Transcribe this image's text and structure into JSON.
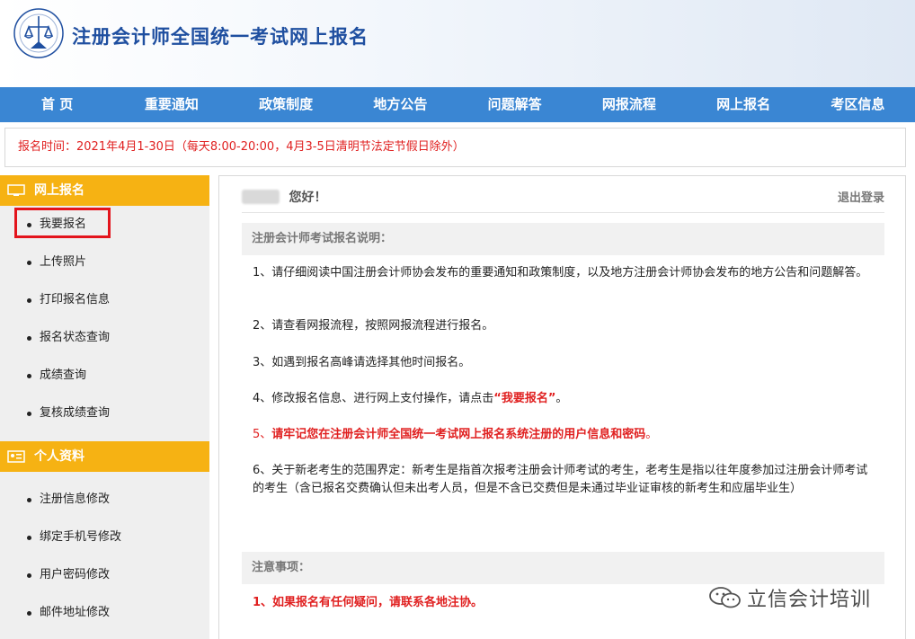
{
  "header": {
    "title": "注册会计师全国统一考试网上报名"
  },
  "nav": [
    "首 页",
    "重要通知",
    "政策制度",
    "地方公告",
    "问题解答",
    "网报流程",
    "网上报名",
    "考区信息"
  ],
  "notice": "报名时间：2021年4月1-30日（每天8:00-20:00，4月3-5日清明节法定节假日除外）",
  "sidebar": {
    "group1": {
      "title": "网上报名",
      "items": [
        "我要报名",
        "上传照片",
        "打印报名信息",
        "报名状态查询",
        "成绩查询",
        "复核成绩查询"
      ]
    },
    "group2": {
      "title": "个人资料",
      "items": [
        "注册信息修改",
        "绑定手机号修改",
        "用户密码修改",
        "邮件地址修改"
      ]
    }
  },
  "main": {
    "greeting": "您好！",
    "logout": "退出登录",
    "section1_title": "注册会计师考试报名说明：",
    "p1": "1、请仔细阅读中国注册会计师协会发布的重要通知和政策制度，以及地方注册会计师协会发布的地方公告和问题解答。",
    "p2": "2、请查看网报流程，按照网报流程进行报名。",
    "p3": "3、如遇到报名高峰请选择其他时间报名。",
    "p4_pre": "4、修改报名信息、进行网上支付操作，请点击",
    "p4_link": "“我要报名”",
    "p4_post": "。",
    "p5_num": "5、",
    "p5": "请牢记您在注册会计师全国统一考试网上报名系统注册的用户信息和密码",
    "p5_end": "。",
    "p6": "6、关于新老考生的范围界定：新考生是指首次报考注册会计师考试的考生，老考生是指以往年度参加过注册会计师考试的考生（含已报名交费确认但未出考人员，但是不含已交费但是未通过毕业证审核的新考生和应届毕业生）",
    "section2_title": "注意事项：",
    "note1": "1、如果报名有任何疑问，请联系各地注协。"
  },
  "watermark": {
    "text": "立信会计培训",
    "icon": "wechat-icon"
  },
  "colors": {
    "nav": "#3a86d3",
    "sidebar_head": "#f6b213",
    "alert": "#e02020",
    "title": "#1f4fa0"
  }
}
